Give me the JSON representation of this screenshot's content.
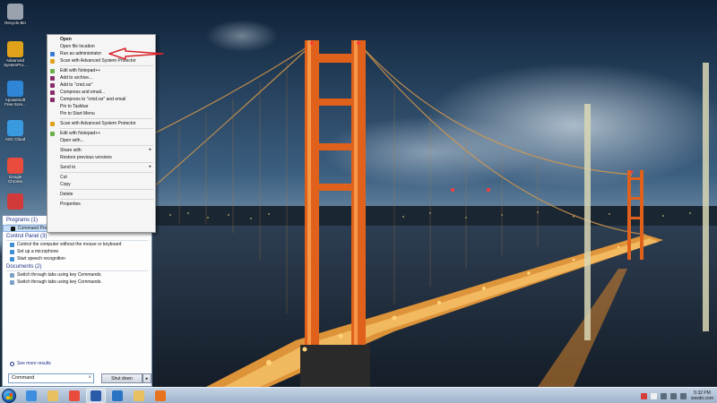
{
  "desktop_icons": [
    {
      "label": "Recycle Bin",
      "icon": "recycle-bin-icon",
      "color": "#9aa3ad"
    },
    {
      "label": "Advanced SystemPro...",
      "icon": "advanced-system-protector-icon",
      "color": "#e0a21a"
    },
    {
      "label": "Apowersoft Free Scre...",
      "icon": "screen-recorder-icon",
      "color": "#2f86d6"
    },
    {
      "label": "ASC Cloud",
      "icon": "cloud-icon",
      "color": "#3a9ae0"
    },
    {
      "label": "Google Chrome",
      "icon": "chrome-icon",
      "color": "#e94b3c"
    },
    {
      "label": "",
      "icon": "app-icon",
      "color": "#d23a3a"
    }
  ],
  "context_menu": {
    "items": [
      {
        "type": "item",
        "label": "Open",
        "bold": true
      },
      {
        "type": "item",
        "label": "Open file location"
      },
      {
        "type": "item",
        "label": "Run as administrator",
        "icon": "shield-icon",
        "icon_color": "#3a7bd5"
      },
      {
        "type": "item",
        "label": "Scan with Advanced System Protector",
        "icon": "asp-icon",
        "icon_color": "#e0a21a"
      },
      {
        "type": "sep"
      },
      {
        "type": "item",
        "label": "Edit with Notepad++",
        "icon": "notepad-icon",
        "icon_color": "#6bb04a"
      },
      {
        "type": "item",
        "label": "Add to archive...",
        "icon": "archive-icon",
        "icon_color": "#8a2a6a"
      },
      {
        "type": "item",
        "label": "Add to \"cmd.rar\"",
        "icon": "archive-icon",
        "icon_color": "#8a2a6a"
      },
      {
        "type": "item",
        "label": "Compress and email...",
        "icon": "archive-icon",
        "icon_color": "#8a2a6a"
      },
      {
        "type": "item",
        "label": "Compress to \"cmd.rar\" and email",
        "icon": "archive-icon",
        "icon_color": "#8a2a6a"
      },
      {
        "type": "item",
        "label": "Pin to Taskbar"
      },
      {
        "type": "item",
        "label": "Pin to Start Menu"
      },
      {
        "type": "sep"
      },
      {
        "type": "item",
        "label": "Scan with Advanced System Protector",
        "icon": "asp-icon",
        "icon_color": "#e0a21a"
      },
      {
        "type": "sep"
      },
      {
        "type": "item",
        "label": "Edit with Notepad++",
        "icon": "notepad-icon",
        "icon_color": "#6bb04a"
      },
      {
        "type": "item",
        "label": "Open with..."
      },
      {
        "type": "sep"
      },
      {
        "type": "item",
        "label": "Share with",
        "arrow": "▸"
      },
      {
        "type": "item",
        "label": "Restore previous versions"
      },
      {
        "type": "sep"
      },
      {
        "type": "item",
        "label": "Send to",
        "arrow": "▸"
      },
      {
        "type": "sep"
      },
      {
        "type": "item",
        "label": "Cut"
      },
      {
        "type": "item",
        "label": "Copy"
      },
      {
        "type": "sep"
      },
      {
        "type": "item",
        "label": "Delete"
      },
      {
        "type": "sep"
      },
      {
        "type": "item",
        "label": "Properties"
      }
    ]
  },
  "start_menu": {
    "programs_header": "Programs (1)",
    "programs": [
      {
        "label": "Command Prompt",
        "selected": true
      }
    ],
    "control_panel_header": "Control Panel (3)",
    "control_panel": [
      {
        "label": "Control the computer without the mouse or keyboard"
      },
      {
        "label": "Set up a microphone"
      },
      {
        "label": "Start speech recognition"
      }
    ],
    "documents_header": "Documents (2)",
    "documents": [
      {
        "label": "Switch through tabs using key Commands."
      },
      {
        "label": "Switch through tabs using key Commands."
      }
    ],
    "see_more": "See more results",
    "search_value": "Command",
    "search_clear": "×",
    "shutdown_label": "Shut down",
    "shutdown_arrow": "▸"
  },
  "taskbar": {
    "buttons": [
      {
        "name": "ie",
        "icon": "ie-icon",
        "color": "#3d8ede"
      },
      {
        "name": "explorer",
        "icon": "folder-icon",
        "color": "#e8c062"
      },
      {
        "name": "chrome",
        "icon": "chrome-icon",
        "color": "#e94b3c"
      },
      {
        "name": "word",
        "icon": "word-icon",
        "color": "#2b5aa8",
        "active": true
      },
      {
        "name": "outlook",
        "icon": "outlook-icon",
        "color": "#2a72c2"
      },
      {
        "name": "folder",
        "icon": "folder-icon",
        "color": "#e8c062"
      },
      {
        "name": "firefox",
        "icon": "firefox-icon",
        "color": "#e8731e"
      }
    ],
    "tray_icons": [
      {
        "icon": "alert-icon",
        "color": "#d53b3b"
      },
      {
        "icon": "flag-icon",
        "color": "#f0f0f0"
      },
      {
        "icon": "battery-icon",
        "color": "#5a6b7c"
      },
      {
        "icon": "network-icon",
        "color": "#5a6b7c"
      },
      {
        "icon": "volume-icon",
        "color": "#5a6b7c"
      }
    ],
    "clock_time": "5:32 PM",
    "clock_date": "wsxdn.com"
  }
}
